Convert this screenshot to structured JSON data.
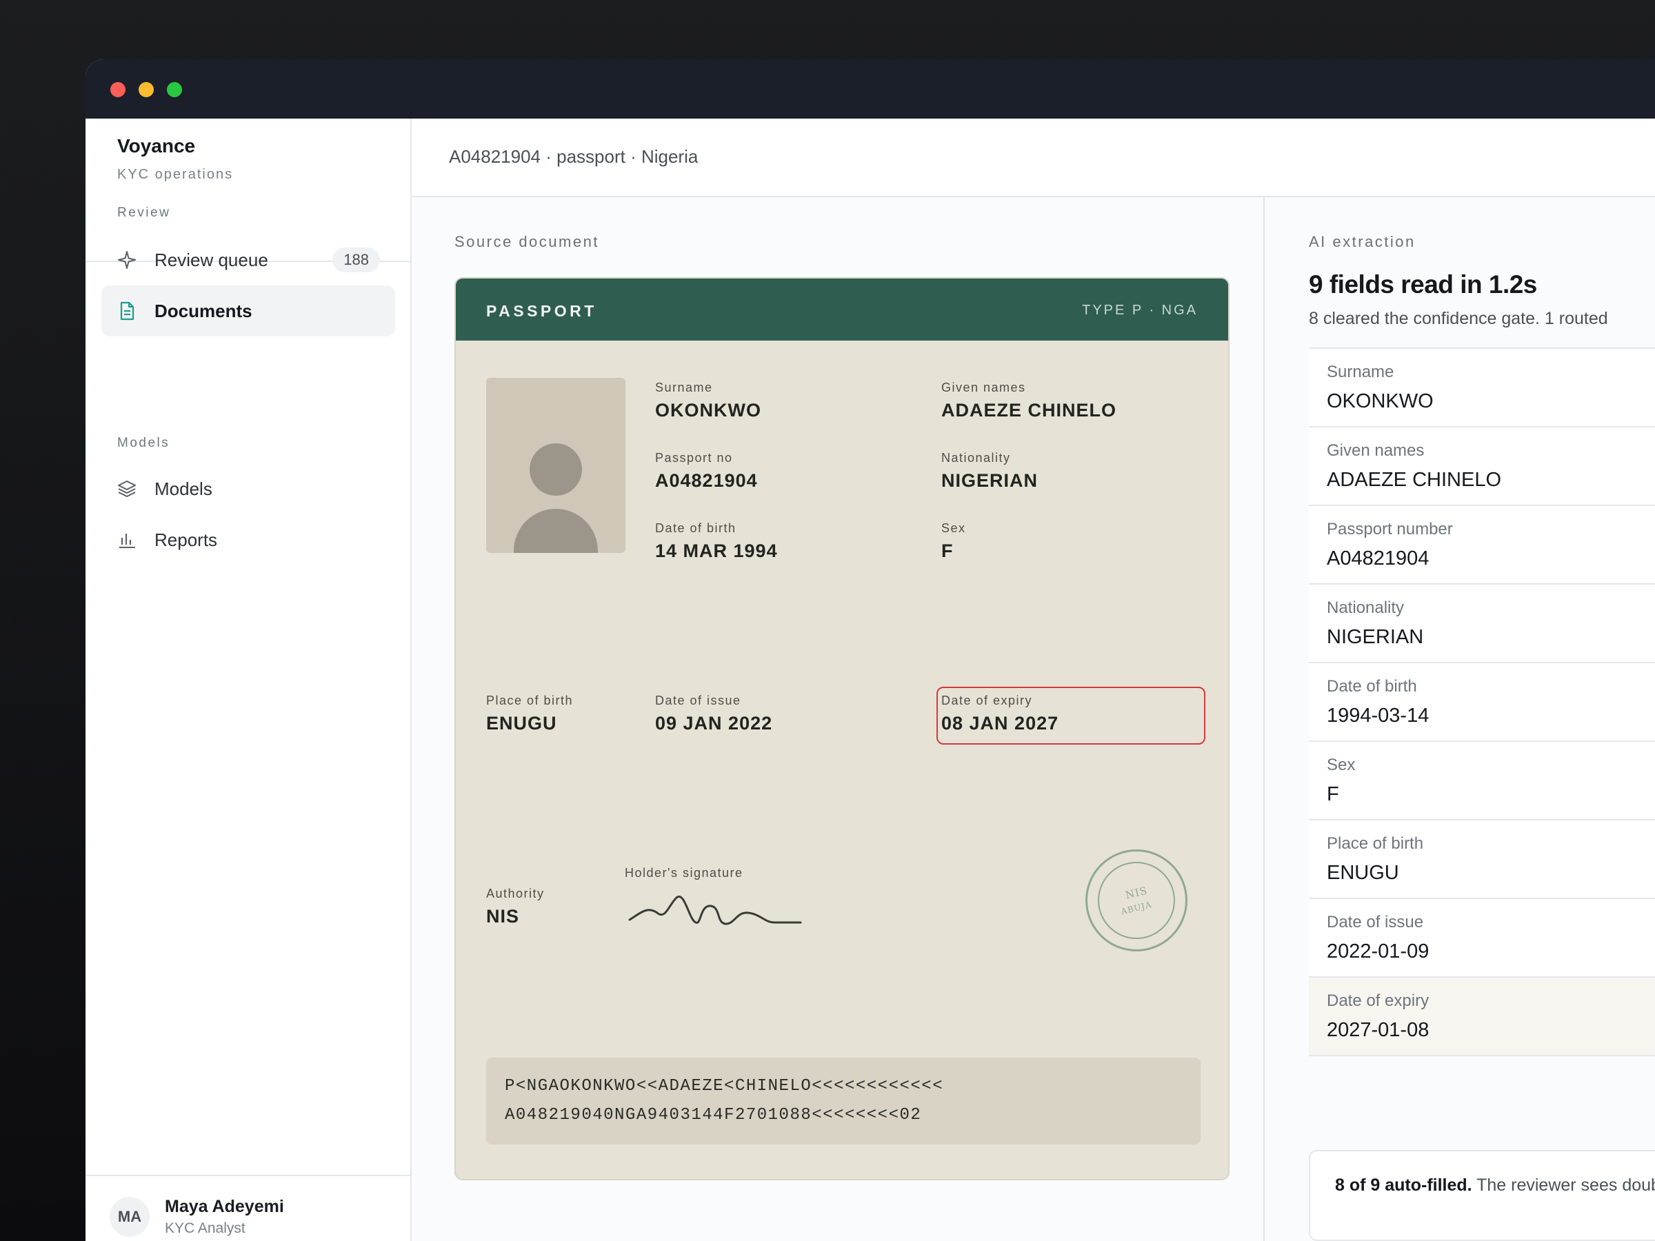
{
  "sidebar": {
    "brand_name": "Voyance",
    "brand_sub": "KYC operations",
    "section_review": "Review",
    "section_models": "Models",
    "items": [
      {
        "label": "Review queue",
        "icon": "sparkle-icon",
        "badge": "188"
      },
      {
        "label": "Documents",
        "icon": "document-icon",
        "active": true
      },
      {
        "label": "Models",
        "icon": "layers-icon"
      },
      {
        "label": "Reports",
        "icon": "bar-chart-icon"
      }
    ],
    "user": {
      "initials": "MA",
      "name": "Maya Adeyemi",
      "role": "KYC Analyst"
    }
  },
  "header": {
    "breadcrumb": "A04821904 · passport · Nigeria"
  },
  "document": {
    "pane_label": "Source document",
    "passport": {
      "title": "PASSPORT",
      "type": "TYPE P · NGA",
      "fields": {
        "surname": {
          "label": "Surname",
          "value": "OKONKWO"
        },
        "given_names": {
          "label": "Given names",
          "value": "ADAEZE CHINELO"
        },
        "passport_no": {
          "label": "Passport no",
          "value": "A04821904"
        },
        "nationality": {
          "label": "Nationality",
          "value": "NIGERIAN"
        },
        "dob": {
          "label": "Date of birth",
          "value": "14 MAR 1994"
        },
        "sex": {
          "label": "Sex",
          "value": "F"
        },
        "pob": {
          "label": "Place of birth",
          "value": "ENUGU"
        },
        "doi": {
          "label": "Date of issue",
          "value": "09 JAN 2022"
        },
        "doe": {
          "label": "Date of expiry",
          "value": "08 JAN 2027"
        },
        "authority": {
          "label": "Authority",
          "value": "NIS"
        },
        "signature_label": "Holder's signature"
      },
      "stamp": {
        "line1": "NIS",
        "line2": "ABUJA"
      },
      "mrz": [
        "P<NGAOKONKWO<<ADAEZE<CHINELO<<<<<<<<<<<<",
        "A048219040NGA9403144F2701088<<<<<<<<02"
      ]
    }
  },
  "extraction": {
    "pane_label": "AI extraction",
    "title": "9 fields read in 1.2s",
    "subtitle": "8 cleared the confidence gate. 1 routed",
    "fields": [
      {
        "label": "Surname",
        "value": "OKONKWO"
      },
      {
        "label": "Given names",
        "value": "ADAEZE CHINELO"
      },
      {
        "label": "Passport number",
        "value": "A04821904"
      },
      {
        "label": "Nationality",
        "value": "NIGERIAN"
      },
      {
        "label": "Date of birth",
        "value": "1994-03-14"
      },
      {
        "label": "Sex",
        "value": "F"
      },
      {
        "label": "Place of birth",
        "value": "ENUGU"
      },
      {
        "label": "Date of issue",
        "value": "2022-01-09"
      },
      {
        "label": "Date of expiry",
        "value": "2027-01-08",
        "flagged": true
      }
    ],
    "summary_bold": "8 of 9 auto-filled.",
    "summary_rest": " The reviewer sees doubts."
  },
  "colors": {
    "passport_header": "#2f5e51",
    "passport_paper": "#e7e2d6",
    "flag": "#d23b3b",
    "accent": "#1a9e8c"
  }
}
